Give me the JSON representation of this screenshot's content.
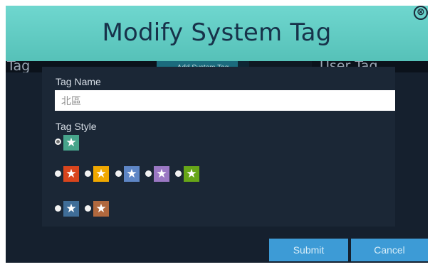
{
  "dialog": {
    "title": "Modify System Tag",
    "close_glyph": "⊗"
  },
  "background": {
    "tag_label": "Tag",
    "add_system_tag_label": "Add System Tag",
    "user_tag_label": "User Tag"
  },
  "form": {
    "tag_name_label": "Tag Name",
    "tag_name_value": "北區",
    "tag_style_label": "Tag Style",
    "styles": [
      {
        "color": "#47a48b",
        "selected": true
      },
      {
        "color": "#d9451d",
        "selected": false
      },
      {
        "color": "#f0a800",
        "selected": false
      },
      {
        "color": "#5e86c6",
        "selected": false
      },
      {
        "color": "#9b78c4",
        "selected": false
      },
      {
        "color": "#67a618",
        "selected": false
      },
      {
        "color": "#3f6d98",
        "selected": false
      },
      {
        "color": "#b0683e",
        "selected": false
      }
    ],
    "star_glyph": "★"
  },
  "buttons": {
    "submit_label": "Submit",
    "cancel_label": "Cancel"
  },
  "colors": {
    "header": "#5fcbc2",
    "modal_bg": "#15202e",
    "panel_bg": "#1b2736",
    "button_bg": "#3d9bd6"
  }
}
